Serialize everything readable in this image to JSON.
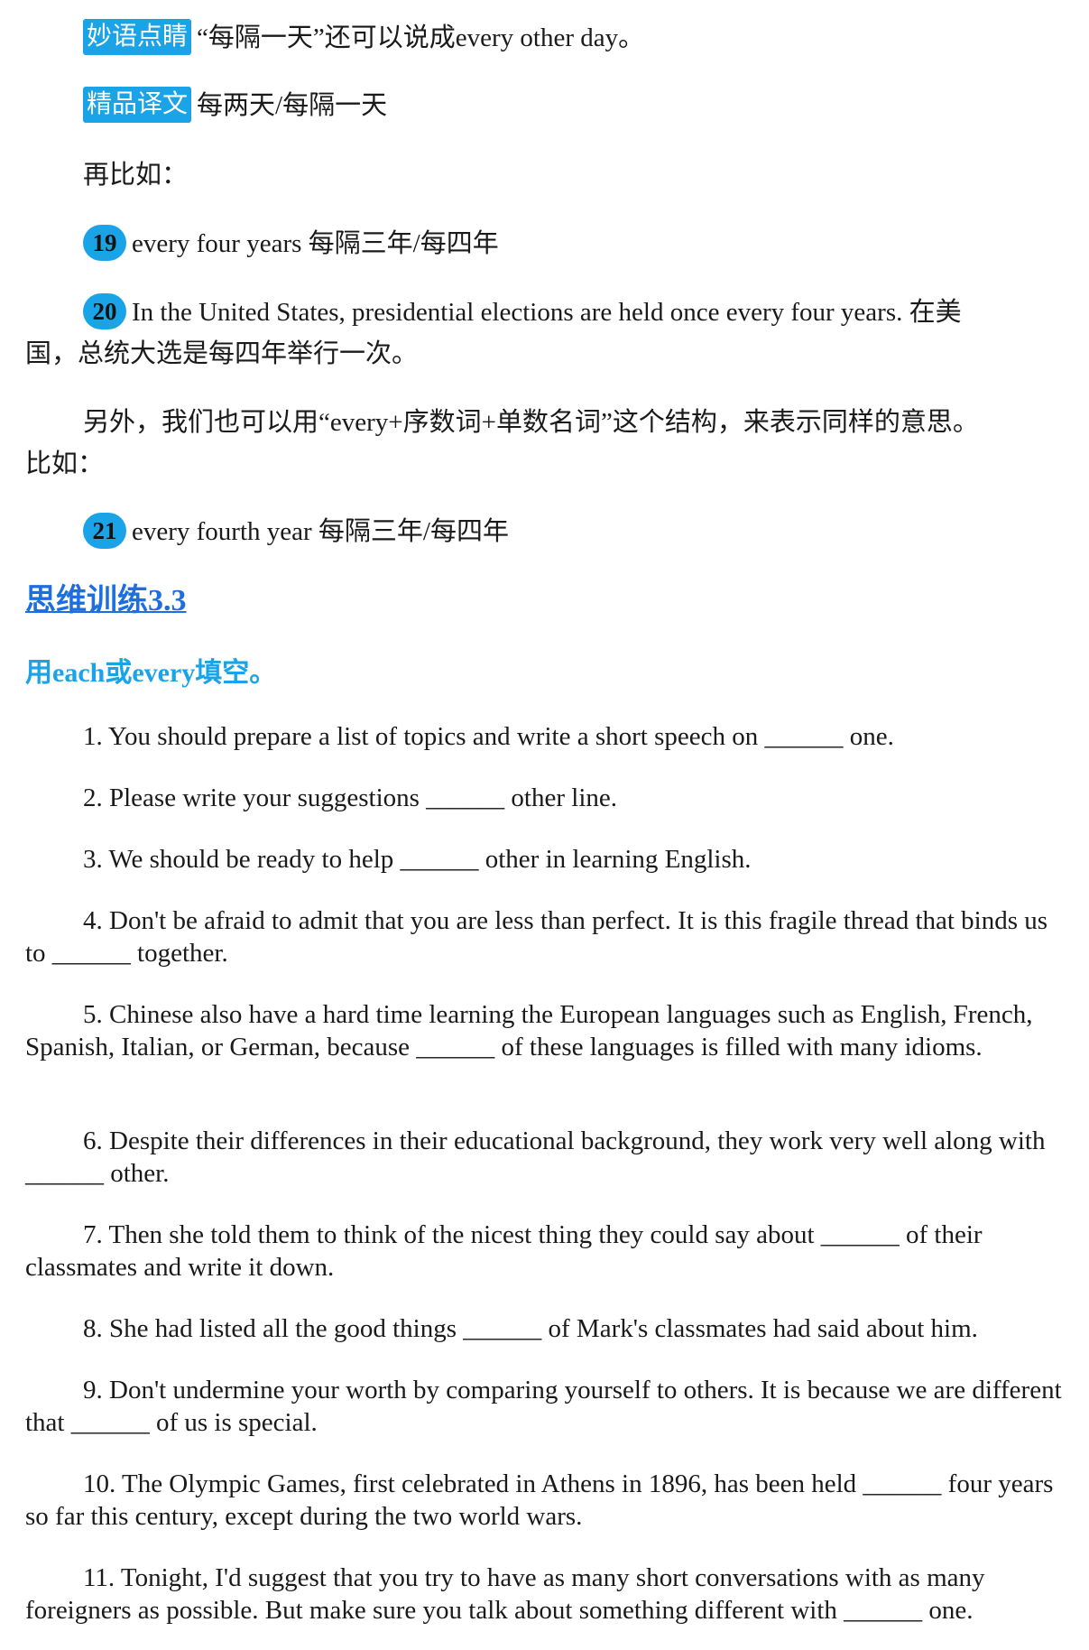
{
  "tip": {
    "tag": "妙语点睛",
    "text": "“每隔一天”还可以说成every other day。"
  },
  "translation": {
    "tag": "精品译文",
    "text": "每两天/每隔一天"
  },
  "more_examples_intro": "再比如：",
  "ex19": {
    "num": "19",
    "text": "every four years 每隔三年/每四年"
  },
  "ex20": {
    "num": "20",
    "text_line1": "In the United States, presidential elections are held once every four years. 在美",
    "text_line2": "国，总统大选是每四年举行一次。"
  },
  "note": {
    "line1": "另外，我们也可以用“every+序数词+单数名词”这个结构，来表示同样的意思。",
    "line2": "比如："
  },
  "ex21": {
    "num": "21",
    "text": "every fourth year 每隔三年/每四年"
  },
  "section": {
    "title": "思维训练3.3",
    "instruction": "用each或every填空。"
  },
  "questions": [
    "1. You should prepare a list of topics and write a short speech on ______ one.",
    "2. Please write your suggestions ______ other line.",
    "3. We should be ready to help ______ other in learning English.",
    "4. Don't be afraid to admit that you are less than perfect. It is this fragile thread that binds us to ______ together.",
    "5. Chinese also have a hard time learning the European languages such as English, French, Spanish, Italian, or German, because ______ of these languages is filled with many idioms.",
    "6. Despite their differences in their educational background, they work very well along with ______ other.",
    "7. Then she told them to think of the nicest thing they could say about ______ of their classmates and write it down.",
    "8. She had listed all the good things ______ of Mark's classmates had said about him.",
    "9. Don't undermine your worth by comparing yourself to others. It is because we are different that ______ of us is special.",
    "10. The Olympic Games, first celebrated in Athens in 1896, has been held ______ four years so far this century, except during the two world wars.",
    "11. Tonight, I'd suggest that you try to have as many short conversations with as many foreigners as possible. But make sure you talk about something different with ______ one."
  ]
}
